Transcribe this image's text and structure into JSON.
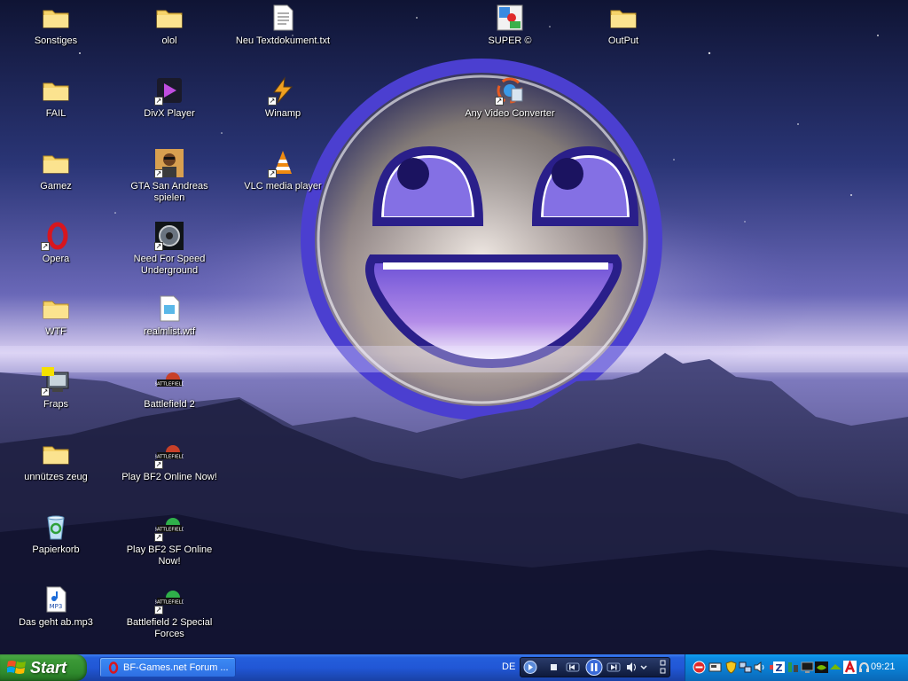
{
  "desktop": {
    "icons": [
      {
        "label": "Sonstiges",
        "type": "folder"
      },
      {
        "label": "FAIL",
        "type": "folder"
      },
      {
        "label": "Gamez",
        "type": "folder"
      },
      {
        "label": "Opera",
        "type": "opera-shortcut"
      },
      {
        "label": "WTF",
        "type": "folder"
      },
      {
        "label": "Fraps",
        "type": "fraps-shortcut"
      },
      {
        "label": "unnützes zeug",
        "type": "folder"
      },
      {
        "label": "Papierkorb",
        "type": "recycle-bin"
      },
      {
        "label": "Das geht ab.mp3",
        "type": "mp3-file"
      },
      {
        "label": "olol",
        "type": "folder"
      },
      {
        "label": "DivX Player",
        "type": "divx-shortcut"
      },
      {
        "label": "GTA San Andreas spielen",
        "type": "gta-shortcut"
      },
      {
        "label": "Need For Speed Underground",
        "type": "nfs-shortcut"
      },
      {
        "label": "realmlist.wtf",
        "type": "wtf-file"
      },
      {
        "label": "Battlefield 2",
        "type": "battlefield-shortcut"
      },
      {
        "label": "Play BF2 Online Now!",
        "type": "battlefield-shortcut"
      },
      {
        "label": "Play BF2 SF Online Now!",
        "type": "battlefield-shortcut"
      },
      {
        "label": "Battlefield 2 Special Forces",
        "type": "battlefield-shortcut"
      },
      {
        "label": "Neu Textdokument.txt",
        "type": "text-file"
      },
      {
        "label": "Winamp",
        "type": "winamp-shortcut"
      },
      {
        "label": "VLC media player",
        "type": "vlc-shortcut"
      },
      {
        "label": "SUPER ©",
        "type": "super-app"
      },
      {
        "label": "Any Video Converter",
        "type": "avc-shortcut"
      },
      {
        "label": "OutPut",
        "type": "folder"
      }
    ]
  },
  "taskbar": {
    "start_label": "Start",
    "tasks": [
      {
        "label": "BF-Games.net Forum ...",
        "icon": "opera-icon"
      }
    ],
    "language": "DE",
    "clock": "09:21"
  },
  "colors": {
    "taskbar_blue": "#245edb",
    "start_green": "#3c9a37",
    "tray_blue": "#0c8ae0"
  }
}
